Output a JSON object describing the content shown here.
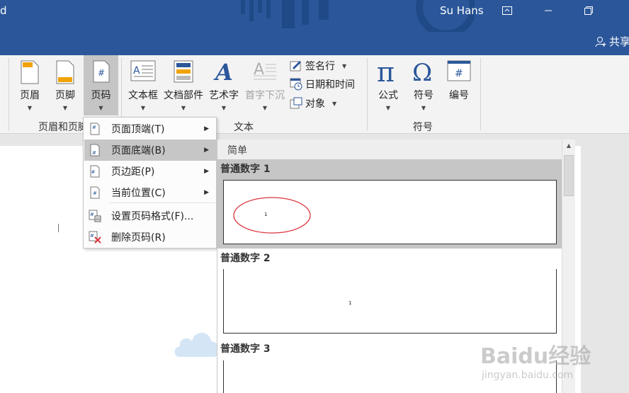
{
  "titlebar": {
    "left_fragment": "d",
    "user": "Su Hans",
    "share_label": "共享"
  },
  "ribbon": {
    "buttons": {
      "header": "页眉",
      "footer": "页脚",
      "page_number": "页码",
      "textbox": "文本框",
      "quick_parts": "文档部件",
      "wordart": "艺术字",
      "dropcap": "首字下沉",
      "equation": "公式",
      "symbol": "符号",
      "numbering": "编号"
    },
    "small": {
      "signature": "签名行",
      "datetime": "日期和时间",
      "object": "对象"
    },
    "groups": {
      "header_footer": "页眉和页脚",
      "text": "文本",
      "symbols": "符号"
    }
  },
  "menu": {
    "items": [
      {
        "label": "页面顶端(T)",
        "submenu": true
      },
      {
        "label": "页面底端(B)",
        "submenu": true
      },
      {
        "label": "页边距(P)",
        "submenu": true
      },
      {
        "label": "当前位置(C)",
        "submenu": true
      },
      {
        "label": "设置页码格式(F)...",
        "submenu": false
      },
      {
        "label": "删除页码(R)",
        "submenu": false
      }
    ],
    "highlighted_index": 1
  },
  "gallery": {
    "section_header": "简单",
    "items": [
      {
        "title": "普通数字 1",
        "number": "1"
      },
      {
        "title": "普通数字 2",
        "number": "1"
      },
      {
        "title": "普通数字 3",
        "number": ""
      }
    ],
    "selected_index": 0
  },
  "watermark": {
    "logo": "Baidu经验",
    "url": "jingyan.baidu.com"
  },
  "colors": {
    "titlebar": "#2b579a",
    "ribbon": "#f3f3f3",
    "highlight": "#c6c6c6",
    "annotation_circle": "#d9363e",
    "icon_blue": "#2b579a"
  }
}
